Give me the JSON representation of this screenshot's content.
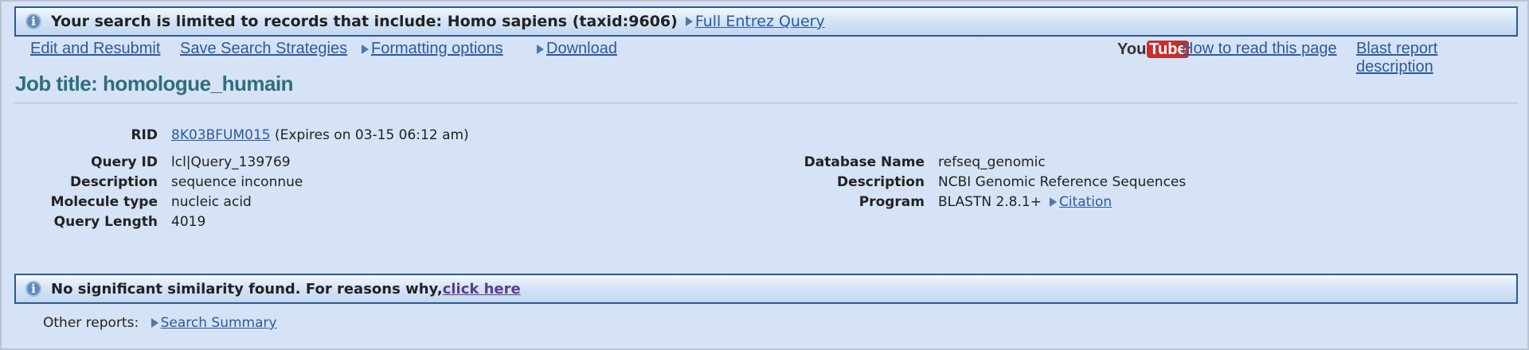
{
  "top_notice": {
    "message": "Your search is limited to records that include: Homo sapiens (taxid:9606)",
    "link": "Full Entrez Query"
  },
  "toolbar": {
    "edit_resubmit": "Edit and Resubmit",
    "save_strategies": "Save Search Strategies",
    "formatting_options": "Formatting options",
    "download": "Download",
    "youtube_you": "You",
    "youtube_tube": "Tube",
    "how_to_read": "How to read this page",
    "blast_report_description": "Blast report description"
  },
  "job_title": "Job title: homologue_humain",
  "rid": {
    "label": "RID",
    "value": "8K03BFUM015",
    "expires": "(Expires on 03-15 06:12 am)"
  },
  "query": {
    "id_label": "Query ID",
    "id_value": "lcl|Query_139769",
    "description_label": "Description",
    "description_value": "sequence inconnue",
    "molecule_label": "Molecule type",
    "molecule_value": "nucleic acid",
    "length_label": "Query Length",
    "length_value": "4019"
  },
  "database": {
    "name_label": "Database Name",
    "name_value": "refseq_genomic",
    "description_label": "Description",
    "description_value": "NCBI Genomic Reference Sequences",
    "program_label": "Program",
    "program_value": "BLASTN 2.8.1+",
    "citation": "Citation"
  },
  "result_notice": {
    "message": "No significant similarity found. For reasons why,",
    "link": "click here"
  },
  "other_reports": {
    "label": "Other reports:",
    "search_summary": "Search Summary"
  },
  "colors": {
    "background": "#d6e2f5",
    "link": "#2b5b9a",
    "title": "#2e6f7e",
    "notice_border": "#2d5a8f",
    "youtube_red": "#c4302b"
  }
}
